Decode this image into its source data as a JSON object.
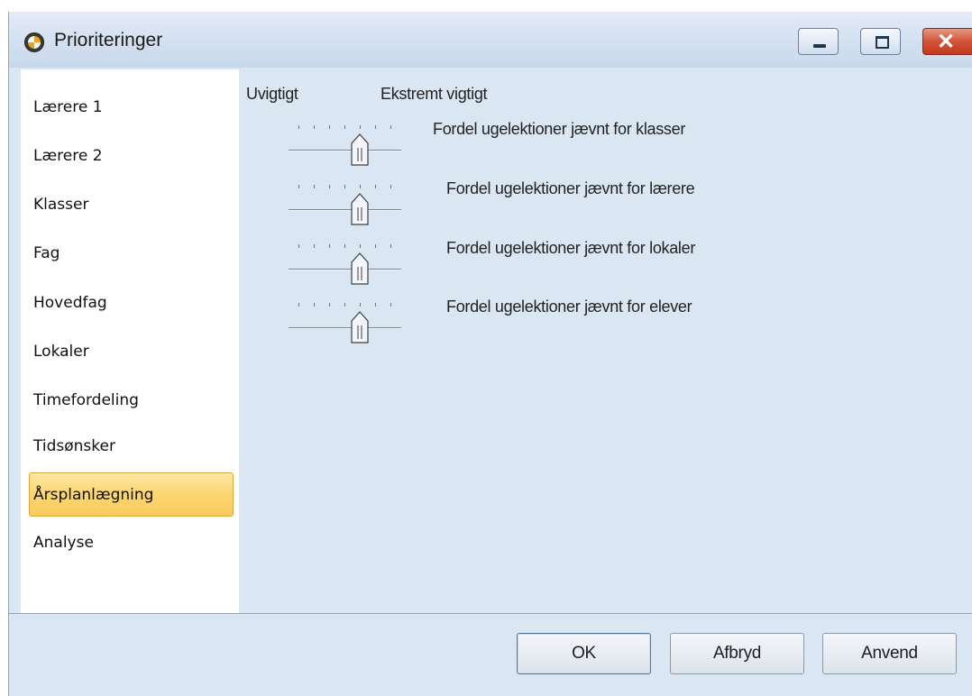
{
  "window": {
    "title": "Prioriteringer",
    "controls": {
      "minimize": "minimize",
      "maximize": "maximize",
      "close": "close"
    }
  },
  "sidebar": {
    "items": [
      {
        "label": "Lærere 1",
        "selected": false
      },
      {
        "label": "Lærere 2",
        "selected": false
      },
      {
        "label": "Klasser",
        "selected": false
      },
      {
        "label": "Fag",
        "selected": false
      },
      {
        "label": "Hovedfag",
        "selected": false
      },
      {
        "label": "Lokaler",
        "selected": false
      },
      {
        "label": "Timefordeling",
        "selected": false
      },
      {
        "label": "Tidsønsker",
        "selected": false
      },
      {
        "label": "Årsplanlægning",
        "selected": true
      },
      {
        "label": "Analyse",
        "selected": false
      }
    ]
  },
  "scale": {
    "low_label": "Uvigtigt",
    "high_label": "Ekstremt vigtigt"
  },
  "priorities": [
    {
      "label": "Fordel ugelektioner jævnt for klasser",
      "value": 4,
      "max": 6
    },
    {
      "label": "Fordel ugelektioner jævnt for lærere",
      "value": 4,
      "max": 6
    },
    {
      "label": "Fordel ugelektioner jævnt for lokaler",
      "value": 4,
      "max": 6
    },
    {
      "label": "Fordel ugelektioner jævnt for elever",
      "value": 4,
      "max": 6
    }
  ],
  "buttons": {
    "ok": "OK",
    "cancel": "Afbryd",
    "apply": "Anvend"
  },
  "colors": {
    "panel_bg": "#dbe6f3",
    "selected_bg": "#fbd774",
    "close_button": "#d45437"
  }
}
